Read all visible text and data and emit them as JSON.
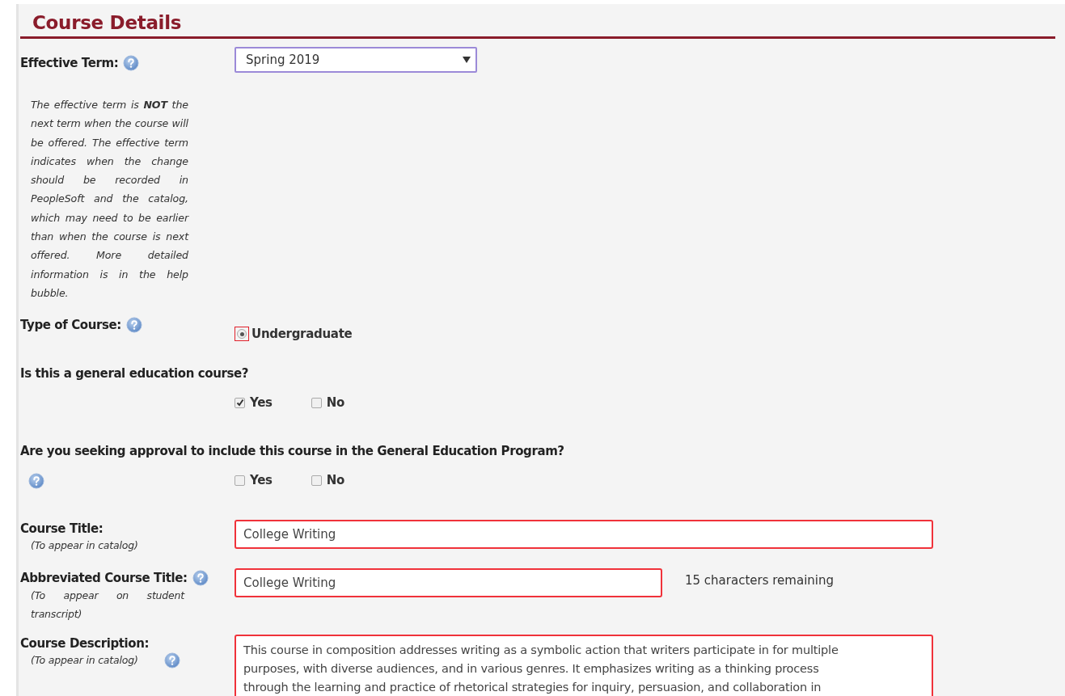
{
  "heading": "Course Details",
  "effective_term": {
    "label": "Effective Term:",
    "help": true,
    "value": "Spring 2019",
    "note": "The effective term is **NOT** the next term when the course will be offered. The effective term indicates when the change should be recorded in PeopleSoft and the catalog, which may need to be earlier than when the course is next offered. More detailed information is in the help bubble."
  },
  "course_type": {
    "label": "Type of Course:",
    "help": true,
    "options": [
      {
        "label": "Undergraduate",
        "selected": true,
        "invalid": true
      }
    ]
  },
  "gen_ed": {
    "question": "Is this a general education course?",
    "options": [
      {
        "label": "Yes",
        "checked": true
      },
      {
        "label": "No",
        "checked": false
      }
    ]
  },
  "gen_ed_approval": {
    "question": "Are you seeking approval to include this course in the General Education Program?",
    "help": true,
    "options": [
      {
        "label": "Yes",
        "checked": false
      },
      {
        "label": "No",
        "checked": false
      }
    ]
  },
  "fields": [
    {
      "kind": "text",
      "label": "Course Title:",
      "hint": "(To appear in catalog)",
      "value": "College Writing",
      "invalid": true
    },
    {
      "kind": "text",
      "label": "Abbreviated Course Title:",
      "hint": "(To appear on student transcript)",
      "help": true,
      "value": "College Writing",
      "invalid": true,
      "counter": "15 characters remaining"
    },
    {
      "kind": "textarea",
      "label": "Course Description:",
      "hint": "(To appear in catalog)",
      "help": true,
      "value": "This course in composition addresses writing as a symbolic action that writers participate in for multiple\npurposes, with diverse audiences, and in various genres. It emphasizes writing as a thinking process\nthrough the learning and practice of rhetorical strategies for inquiry, persuasion, and collaboration in",
      "invalid": true
    }
  ]
}
